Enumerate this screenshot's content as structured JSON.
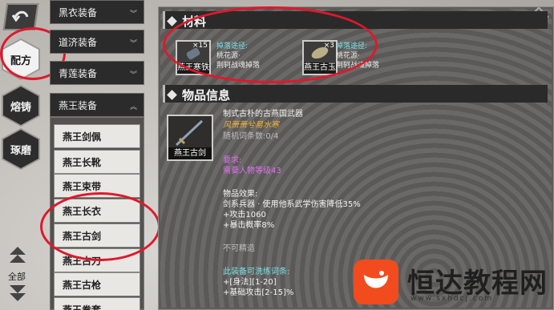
{
  "tabs": {
    "recipe": "配方",
    "smelt": "熔铸",
    "polish": "琢磨",
    "all": "全部"
  },
  "categories": [
    "黑衣装备",
    "道济装备",
    "青莲装备",
    "燕王装备"
  ],
  "items": [
    "燕王剑佩",
    "燕王长靴",
    "燕王束带",
    "燕王长衣",
    "燕王古剑",
    "燕王古刀",
    "燕王古枪",
    "燕王拳套"
  ],
  "materials": {
    "title": "材料",
    "list": [
      {
        "name": "燕王寒铁",
        "count": "×15",
        "source_label": "掉落途径:",
        "source_lines": [
          "桃花源·",
          "荆轲战魂掉落"
        ]
      },
      {
        "name": "燕王古玉",
        "count": "×3",
        "source_label": "掉落途径:",
        "source_lines": [
          "桃花源·",
          "荆轲战魂掉落"
        ]
      }
    ]
  },
  "info": {
    "title": "物品信息",
    "item_name": "燕王古剑",
    "desc": "制式古朴的古燕国武器",
    "flavor": "风萧萧兮易水寒",
    "random_count": "随机词条数:0/4",
    "req_label": "要求:",
    "req_value": "需要人物等级43",
    "effect_label": "物品效果:",
    "effect_lines": [
      "剑系兵器 · 使用他系武学伤害降低35%",
      "+攻击1060",
      "+暴击概率8%"
    ],
    "not_tradable": "不可精造",
    "wash_label": "此装备可洗练词条:",
    "wash_lines": [
      "+[身法][1-20]",
      "+基础攻击[2-15]%"
    ]
  },
  "watermark": {
    "text": "恒达教程网",
    "url": "www.sxhdcj.com"
  },
  "colors": {
    "highlight_circle": "#e0182c",
    "watermark_brand": "#f24b1e"
  }
}
